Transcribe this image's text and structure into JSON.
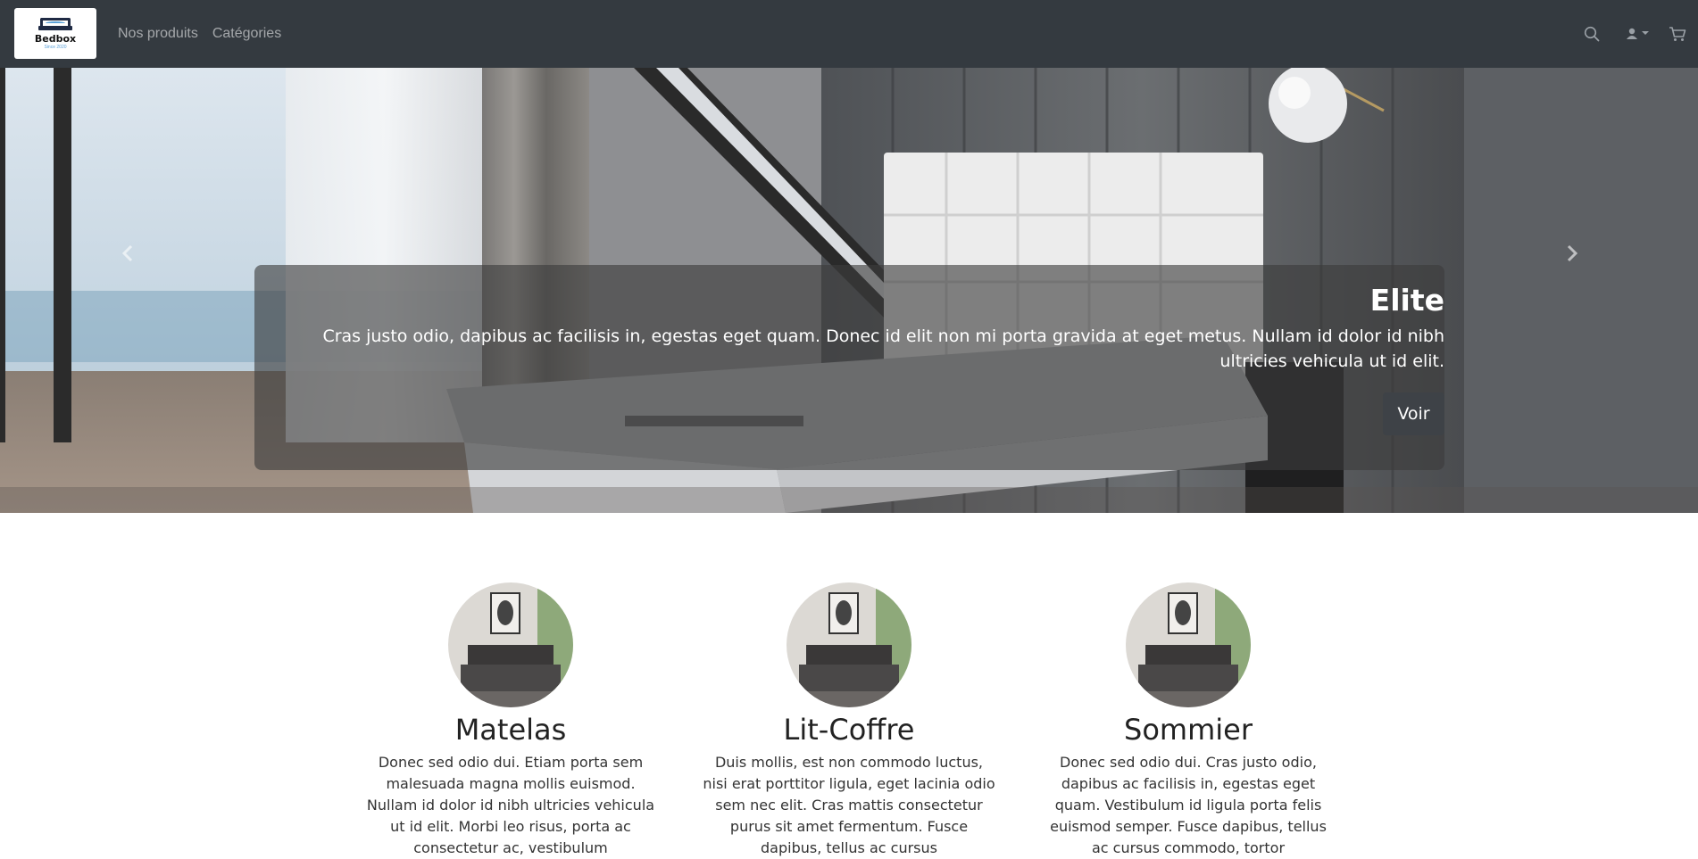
{
  "brand": {
    "name": "Bedbox",
    "since": "Since 2020"
  },
  "nav": {
    "products": "Nos produits",
    "categories": "Catégories"
  },
  "carousel": {
    "title": "Elite",
    "text": "Cras justo odio, dapibus ac facilisis in, egestas eget quam. Donec id elit non mi porta gravida at eget metus. Nullam id dolor id nibh ultricies vehicula ut id elit.",
    "button": "Voir",
    "prev_icon": "chevron-left-icon",
    "next_icon": "chevron-right-icon"
  },
  "features": [
    {
      "title": "Matelas",
      "text": "Donec sed odio dui. Etiam porta sem malesuada magna mollis euismod. Nullam id dolor id nibh ultricies vehicula ut id elit. Morbi leo risus, porta ac consectetur ac, vestibulum"
    },
    {
      "title": "Lit-Coffre",
      "text": "Duis mollis, est non commodo luctus, nisi erat porttitor ligula, eget lacinia odio sem nec elit. Cras mattis consectetur purus sit amet fermentum. Fusce dapibus, tellus ac cursus"
    },
    {
      "title": "Sommier",
      "text": "Donec sed odio dui. Cras justo odio, dapibus ac facilisis in, egestas eget quam. Vestibulum id ligula porta felis euismod semper. Fusce dapibus, tellus ac cursus commodo, tortor"
    }
  ],
  "colors": {
    "navbar": "#343a40",
    "caption_bg": "#3c3c3c",
    "button": "#3e4247"
  }
}
